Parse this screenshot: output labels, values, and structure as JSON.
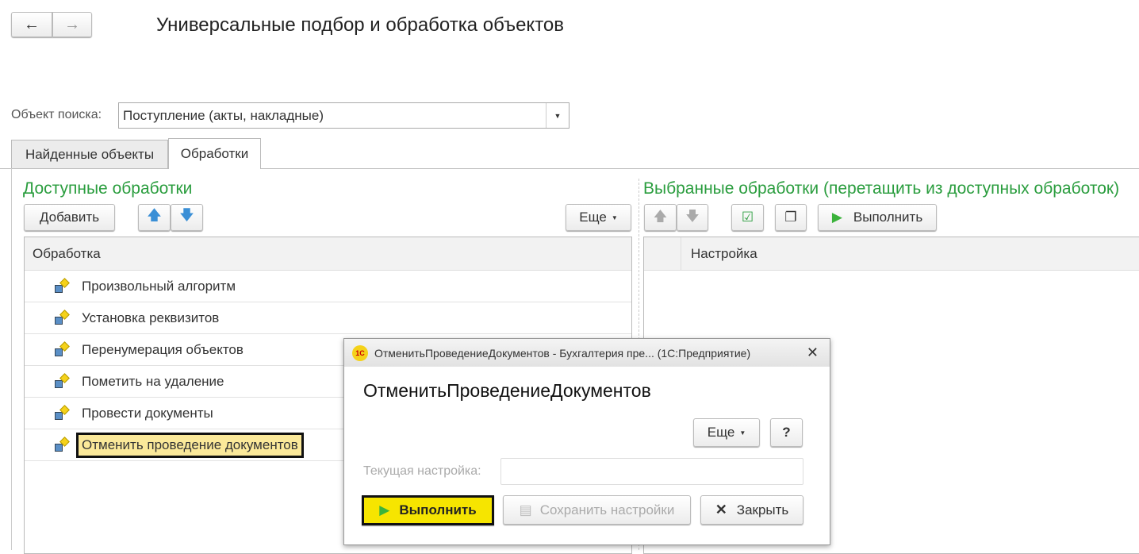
{
  "header": {
    "title": "Универсальные подбор и обработка объектов",
    "back": "←",
    "forward": "→"
  },
  "search": {
    "label": "Объект поиска:",
    "value": "Поступление (акты, накладные)"
  },
  "tabs": [
    {
      "label": "Найденные объекты"
    },
    {
      "label": "Обработки"
    }
  ],
  "left": {
    "title": "Доступные обработки",
    "add": "Добавить",
    "more": "Еще",
    "column": "Обработка",
    "items": [
      "Произвольный алгоритм",
      "Установка реквизитов",
      "Перенумерация объектов",
      "Пометить на удаление",
      "Провести документы",
      "Отменить проведение документов"
    ]
  },
  "right": {
    "title": "Выбранные обработки (перетащить из доступных обработок)",
    "run": "Выполнить",
    "column": "Настройка"
  },
  "dialog": {
    "window_title": "ОтменитьПроведениеДокументов - Бухгалтерия пре... (1С:Предприятие)",
    "logo": "1С",
    "heading": "ОтменитьПроведениеДокументов",
    "more": "Еще",
    "help": "?",
    "setting_label": "Текущая настройка:",
    "setting_value": "",
    "run": "Выполнить",
    "save": "Сохранить настройки",
    "close": "Закрыть"
  }
}
